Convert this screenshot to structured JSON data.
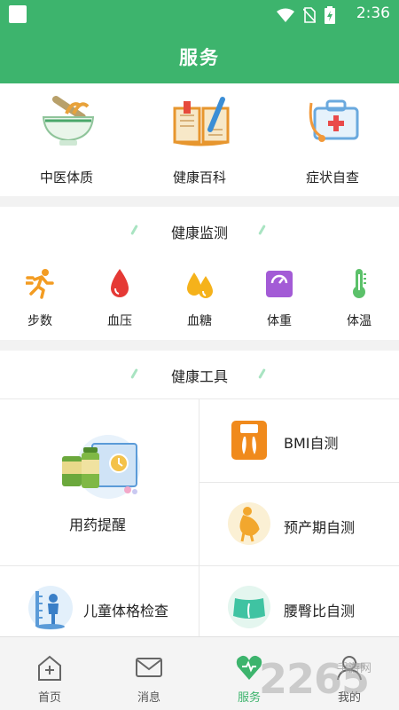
{
  "status_bar": {
    "time": "2:36"
  },
  "header": {
    "title": "服务"
  },
  "services": [
    {
      "label": "中医体质",
      "icon": "herbal-mortar-icon"
    },
    {
      "label": "健康百科",
      "icon": "encyclopedia-book-icon"
    },
    {
      "label": "症状自查",
      "icon": "medical-kit-icon"
    }
  ],
  "monitor": {
    "title": "健康监测",
    "items": [
      {
        "label": "步数",
        "icon": "running-icon",
        "color": "#f39c22"
      },
      {
        "label": "血压",
        "icon": "blood-drop-icon",
        "color": "#e53935"
      },
      {
        "label": "血糖",
        "icon": "sugar-drops-icon",
        "color": "#f5b21b"
      },
      {
        "label": "体重",
        "icon": "scale-icon",
        "color": "#a35bd6"
      },
      {
        "label": "体温",
        "icon": "thermometer-icon",
        "color": "#5cc16a"
      }
    ]
  },
  "tools": {
    "title": "健康工具",
    "medication": "用药提醒",
    "bmi": "BMI自测",
    "due_date": "预产期自测",
    "child": "儿童体格检查",
    "waist_hip": "腰臀比自测"
  },
  "nav": [
    {
      "label": "首页",
      "icon": "home-icon"
    },
    {
      "label": "消息",
      "icon": "mail-icon"
    },
    {
      "label": "服务",
      "icon": "heart-icon"
    },
    {
      "label": "我的",
      "icon": "user-icon"
    }
  ],
  "watermark": {
    "brand": "2265",
    "sub": "手游网"
  }
}
